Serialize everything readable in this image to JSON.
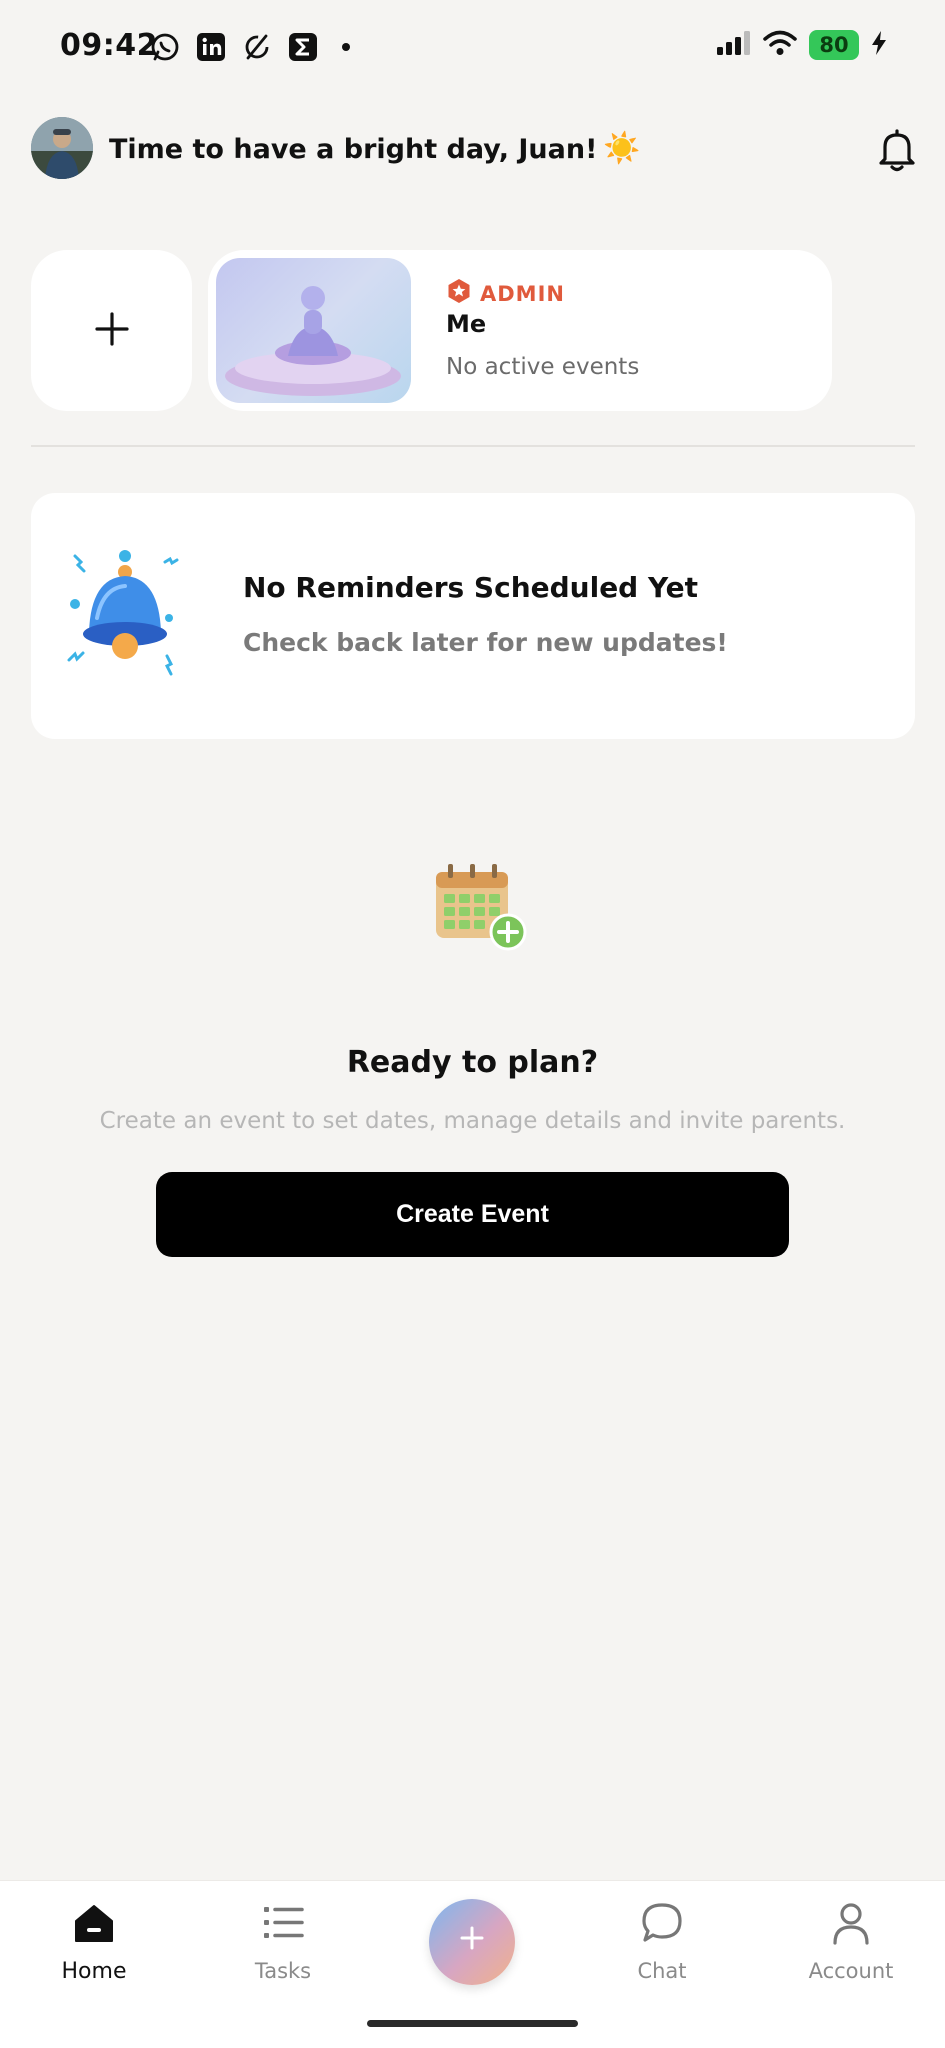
{
  "status_bar": {
    "time": "09:42",
    "battery": "80",
    "app_icons": [
      "whatsapp-icon",
      "linkedin-icon",
      "sync-icon",
      "sigma-icon"
    ]
  },
  "header": {
    "greeting": "Time to have a bright day, Juan!",
    "greeting_emoji": "☀️"
  },
  "groups": {
    "add_icon": "plus-icon",
    "items": [
      {
        "role": "ADMIN",
        "name": "Me",
        "subtitle": "No active events"
      }
    ]
  },
  "reminders": {
    "title": "No Reminders Scheduled Yet",
    "subtitle": "Check back later for new updates!"
  },
  "empty_state": {
    "title": "Ready to plan?",
    "subtitle": "Create an event to set dates, manage details and invite parents.",
    "button_label": "Create Event"
  },
  "bottom_nav": {
    "items": [
      {
        "label": "Home",
        "icon": "home-icon",
        "active": true
      },
      {
        "label": "Tasks",
        "icon": "list-icon",
        "active": false
      },
      {
        "label": "Chat",
        "icon": "chat-icon",
        "active": false
      },
      {
        "label": "Account",
        "icon": "person-icon",
        "active": false
      }
    ],
    "center_icon": "plus-icon"
  },
  "colors": {
    "background": "#f5f4f2",
    "admin_accent": "#e05a3c",
    "battery": "#34c759",
    "button": "#000000"
  }
}
